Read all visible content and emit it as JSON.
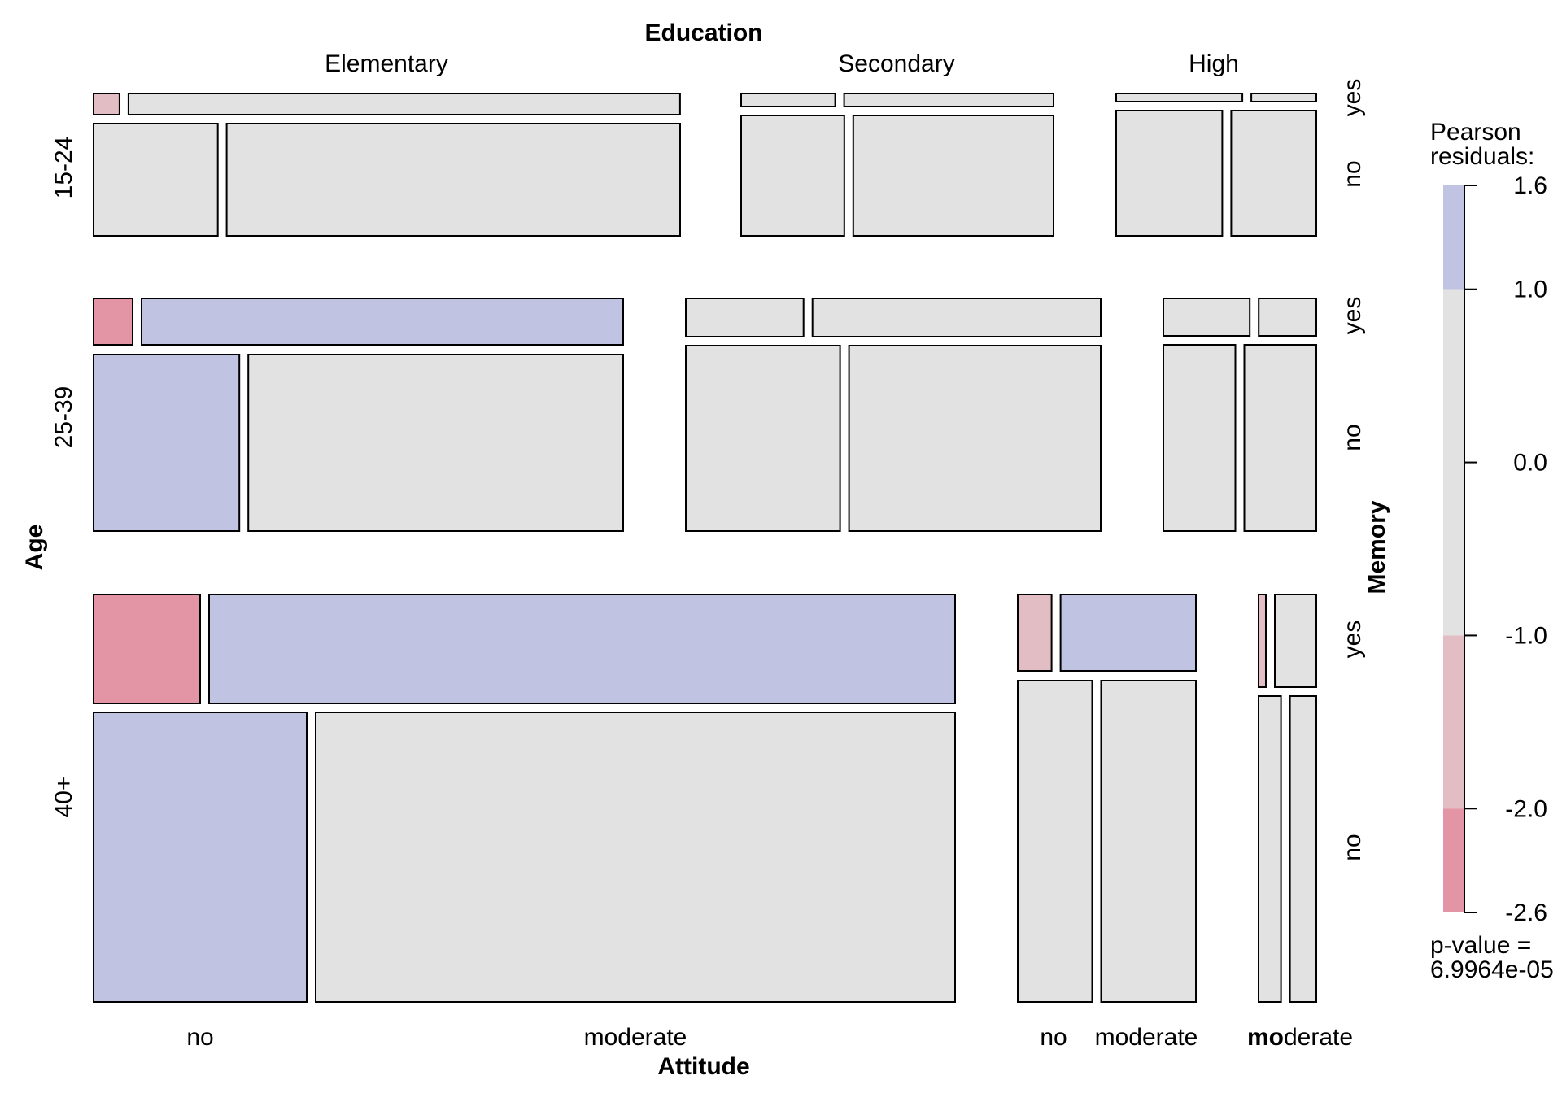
{
  "chart_data": {
    "type": "mosaic",
    "title": "",
    "variables": {
      "top": "Education",
      "left": "Age",
      "bottom": "Attitude",
      "right": "Memory"
    },
    "education_levels": [
      "Elementary",
      "Secondary",
      "High"
    ],
    "age_groups": [
      "15-24",
      "25-39",
      "40+"
    ],
    "memory_levels": [
      "yes",
      "no"
    ],
    "attitude_tick_labels": [
      "no",
      "moderate",
      "no",
      "moderate",
      "moderate"
    ],
    "attitude_tick_bold_prefix": "mo",
    "attitude_tick_bold_suffix": "derate",
    "residual_colors": {
      "strong_negative": "#E495A5",
      "negative": "#E2BEC4",
      "neutral": "#E2E2E2",
      "positive": "#C0C3E2"
    },
    "cells": [
      {
        "age": "15-24",
        "education": "Elementary",
        "memory": "yes",
        "attitude_proportions": [
          0.045,
          0.955
        ],
        "shading": [
          "negative",
          "neutral"
        ]
      },
      {
        "age": "15-24",
        "education": "Elementary",
        "memory": "no",
        "attitude_proportions": [
          0.215,
          0.785
        ],
        "shading": [
          "neutral",
          "neutral"
        ]
      },
      {
        "age": "15-24",
        "education": "Secondary",
        "memory": "yes",
        "attitude_proportions": [
          0.31,
          0.69
        ],
        "shading": [
          "neutral",
          "neutral"
        ]
      },
      {
        "age": "15-24",
        "education": "Secondary",
        "memory": "no",
        "attitude_proportions": [
          0.34,
          0.66
        ],
        "shading": [
          "neutral",
          "neutral"
        ]
      },
      {
        "age": "15-24",
        "education": "High",
        "memory": "yes",
        "attitude_proportions": [
          0.66,
          0.34
        ],
        "shading": [
          "neutral",
          "neutral"
        ]
      },
      {
        "age": "15-24",
        "education": "High",
        "memory": "no",
        "attitude_proportions": [
          0.555,
          0.445
        ],
        "shading": [
          "neutral",
          "neutral"
        ]
      },
      {
        "age": "25-39",
        "education": "Elementary",
        "memory": "yes",
        "attitude_proportions": [
          0.075,
          0.925
        ],
        "shading": [
          "strong_negative",
          "positive"
        ]
      },
      {
        "age": "25-39",
        "education": "Elementary",
        "memory": "no",
        "attitude_proportions": [
          0.28,
          0.72
        ],
        "shading": [
          "positive",
          "neutral"
        ]
      },
      {
        "age": "25-39",
        "education": "Secondary",
        "memory": "yes",
        "attitude_proportions": [
          0.29,
          0.71
        ],
        "shading": [
          "neutral",
          "neutral"
        ]
      },
      {
        "age": "25-39",
        "education": "Secondary",
        "memory": "no",
        "attitude_proportions": [
          0.38,
          0.62
        ],
        "shading": [
          "neutral",
          "neutral"
        ]
      },
      {
        "age": "25-39",
        "education": "High",
        "memory": "yes",
        "attitude_proportions": [
          0.6,
          0.4
        ],
        "shading": [
          "neutral",
          "neutral"
        ]
      },
      {
        "age": "25-39",
        "education": "High",
        "memory": "no",
        "attitude_proportions": [
          0.5,
          0.5
        ],
        "shading": [
          "neutral",
          "neutral"
        ]
      },
      {
        "age": "40+",
        "education": "Elementary",
        "memory": "yes",
        "attitude_proportions": [
          0.125,
          0.875
        ],
        "shading": [
          "strong_negative",
          "positive"
        ]
      },
      {
        "age": "40+",
        "education": "Elementary",
        "memory": "no",
        "attitude_proportions": [
          0.25,
          0.75
        ],
        "shading": [
          "positive",
          "neutral"
        ]
      },
      {
        "age": "40+",
        "education": "Secondary",
        "memory": "yes",
        "attitude_proportions": [
          0.2,
          0.8
        ],
        "shading": [
          "negative",
          "positive"
        ]
      },
      {
        "age": "40+",
        "education": "Secondary",
        "memory": "no",
        "attitude_proportions": [
          0.44,
          0.56
        ],
        "shading": [
          "neutral",
          "neutral"
        ]
      },
      {
        "age": "40+",
        "education": "High",
        "memory": "yes",
        "attitude_proportions": [
          0.15,
          0.85
        ],
        "shading": [
          "negative",
          "neutral"
        ]
      },
      {
        "age": "40+",
        "education": "High",
        "memory": "no",
        "attitude_proportions": [
          0.46,
          0.54
        ],
        "shading": [
          "neutral",
          "neutral"
        ]
      }
    ],
    "legend": {
      "title_line1": "Pearson",
      "title_line2": "residuals:",
      "ticks": [
        1.6,
        1.0,
        0.0,
        -1.0,
        -2.0,
        -2.6
      ],
      "tick_labels": [
        "1.6",
        "1.0",
        "0.0",
        "-1.0",
        "-2.0",
        "-2.6"
      ],
      "bands": [
        {
          "from": 1.0,
          "to": 1.6,
          "color": "#C0C3E2"
        },
        {
          "from": -1.0,
          "to": 1.0,
          "color": "#E2E2E2"
        },
        {
          "from": -2.0,
          "to": -1.0,
          "color": "#E2BEC4"
        },
        {
          "from": -2.6,
          "to": -2.0,
          "color": "#E495A5"
        }
      ],
      "pvalue_line1": "p-value =",
      "pvalue_line2": "6.9964e-05"
    }
  }
}
